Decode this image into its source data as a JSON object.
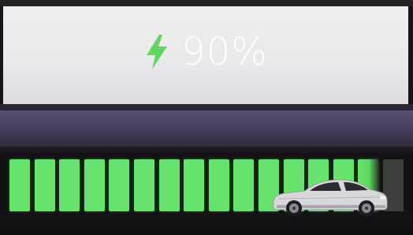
{
  "display": {
    "charge_percent_text": "90%",
    "charge_level": 0.9,
    "charging_icon": "lightning-bolt-icon"
  },
  "battery_bar": {
    "segment_count": 16,
    "filled_segments": 14,
    "partial_segments": 1,
    "fill_color": "#66e36a",
    "empty_color": "#3c3f3c"
  },
  "vehicle_icon": "car-icon",
  "colors": {
    "accent": "#66e36a",
    "text": "#ffffff",
    "dash": "#4a3f5f"
  }
}
